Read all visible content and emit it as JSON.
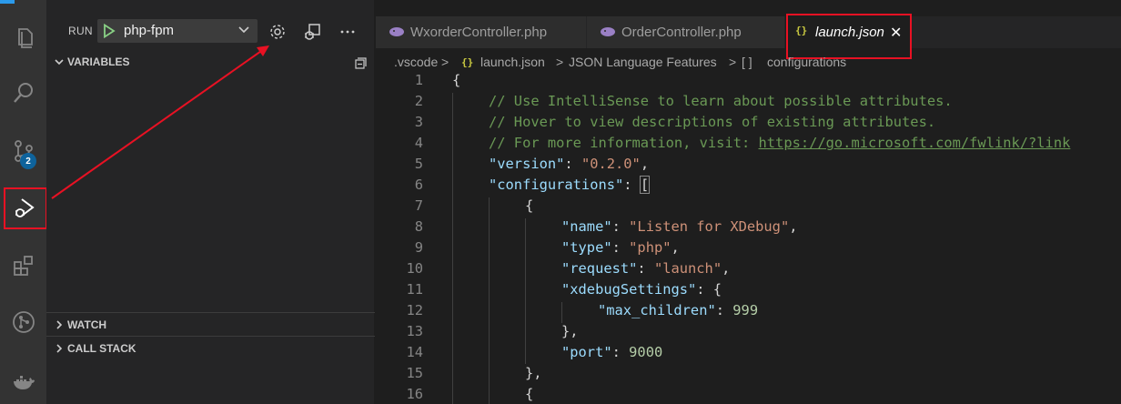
{
  "activity_bar": {
    "scm_badge": "2",
    "items": [
      "explorer-icon",
      "search-icon",
      "source-control-icon",
      "run-debug-icon",
      "extensions-icon",
      "git-graph-icon",
      "docker-icon"
    ],
    "accent": "#0e639c"
  },
  "sidebar": {
    "run_label": "RUN",
    "config_name": "php-fpm",
    "sections": {
      "variables": "VARIABLES",
      "watch": "WATCH",
      "call_stack": "CALL STACK"
    }
  },
  "tabs": [
    {
      "label": "WxorderController.php",
      "icon": "php-icon"
    },
    {
      "label": "OrderController.php",
      "icon": "php-icon"
    },
    {
      "label": "launch.json",
      "icon": "json-icon",
      "active": true
    }
  ],
  "breadcrumb": [
    ".vscode",
    "launch.json",
    "JSON Language Features",
    "configurations"
  ],
  "breadcrumb_glyphs": {
    "json": "{}",
    "array": "[ ]",
    "sep": ">"
  },
  "editor": {
    "line_numbers": [
      "1",
      "2",
      "3",
      "4",
      "5",
      "6",
      "7",
      "8",
      "9",
      "10",
      "11",
      "12",
      "13",
      "14",
      "15",
      "16"
    ],
    "lines": [
      "{",
      "// Use IntelliSense to learn about possible attributes.",
      "// Hover to view descriptions of existing attributes.",
      "// For more information, visit: ",
      "\"version\"",
      "\"configurations\"",
      "{",
      "\"name\"",
      "\"type\"",
      "\"request\"",
      "\"xdebugSettings\"",
      "\"max_children\"",
      "},",
      "\"port\"",
      "},",
      "{"
    ],
    "url": "https://go.microsoft.com/fwlink/?link",
    "values": {
      "version": "\"0.2.0\"",
      "name": "\"Listen for XDebug\"",
      "type": "\"php\"",
      "request": "\"launch\"",
      "max_children": "999",
      "port": "9000"
    }
  },
  "annotation_color": "#e81123"
}
